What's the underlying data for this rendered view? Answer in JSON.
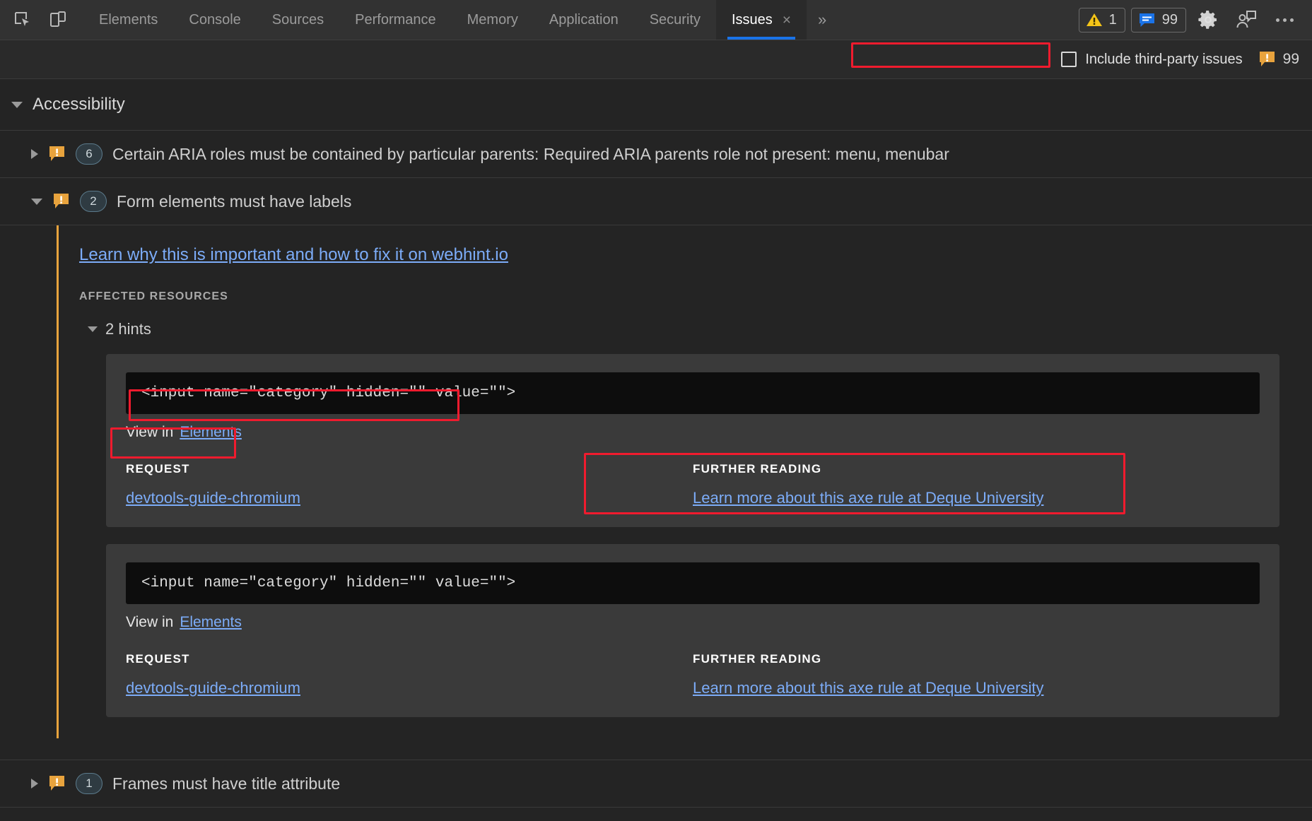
{
  "toolbar": {
    "icons": [
      {
        "name": "inspect-element-icon",
        "label": "Inspect element"
      },
      {
        "name": "device-toolbar-icon",
        "label": "Toggle device toolbar"
      }
    ],
    "tabs": [
      {
        "label": "Elements",
        "active": false
      },
      {
        "label": "Console",
        "active": false
      },
      {
        "label": "Sources",
        "active": false
      },
      {
        "label": "Performance",
        "active": false
      },
      {
        "label": "Memory",
        "active": false
      },
      {
        "label": "Application",
        "active": false
      },
      {
        "label": "Security",
        "active": false
      },
      {
        "label": "Issues",
        "active": true
      }
    ],
    "tab_close_glyph": "×",
    "more_tabs_glyph": "»",
    "warning_count": "1",
    "issues_count": "99",
    "settings_label": "Settings",
    "feedback_label": "Send feedback",
    "more_options_label": "More options"
  },
  "filterbar": {
    "third_party_label": "Include third-party issues",
    "third_party_checked": false,
    "issue_count": "99"
  },
  "categories": [
    {
      "name": "Accessibility",
      "expanded": true,
      "issues": [
        {
          "title": "Certain ARIA roles must be contained by particular parents: Required ARIA parents role not present: menu, menubar",
          "count": "6",
          "expanded": false
        },
        {
          "title": "Form elements must have labels",
          "count": "2",
          "expanded": true,
          "learn_link": "Learn why this is important and how to fix it on webhint.io",
          "affected_resources_label": "AFFECTED RESOURCES",
          "hints_label": "2 hints",
          "request_label": "REQUEST",
          "further_reading_label": "FURTHER READING",
          "view_in_label": "View in",
          "view_in_link": "Elements",
          "hints": [
            {
              "code": "<input name=\"category\" hidden=\"\" value=\"\">",
              "request_link": "devtools-guide-chromium",
              "reading_link": "Learn more about this axe rule at Deque University"
            },
            {
              "code": "<input name=\"category\" hidden=\"\" value=\"\">",
              "request_link": "devtools-guide-chromium",
              "reading_link": "Learn more about this axe rule at Deque University"
            }
          ]
        },
        {
          "title": "Frames must have title attribute",
          "count": "1",
          "expanded": false
        }
      ]
    }
  ],
  "colors": {
    "accent_blue": "#1a73e8",
    "link_blue": "#7cacf8",
    "issue_orange": "#e8a33d",
    "annotation_red": "#f01b2e",
    "warning_yellow": "#f5c518"
  }
}
